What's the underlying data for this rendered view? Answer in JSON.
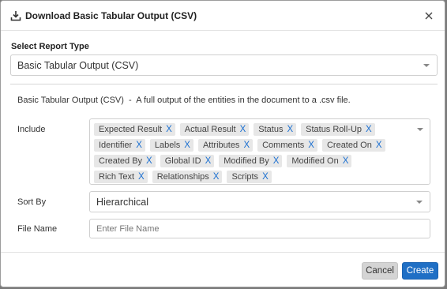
{
  "dialog": {
    "title": "Download Basic Tabular Output (CSV)",
    "title_icon": "download-icon",
    "close_icon": "close-icon"
  },
  "report_type": {
    "label": "Select Report Type",
    "value": "Basic Tabular Output (CSV)"
  },
  "description": "Basic Tabular Output (CSV)  -  A full output of the entities in the document to a .csv file.",
  "include": {
    "label": "Include",
    "remove_label": "X",
    "chips": [
      "Expected Result",
      "Actual Result",
      "Status",
      "Status Roll-Up",
      "Identifier",
      "Labels",
      "Attributes",
      "Comments",
      "Created On",
      "Created By",
      "Global ID",
      "Modified By",
      "Modified On",
      "Rich Text",
      "Relationships",
      "Scripts"
    ]
  },
  "sort_by": {
    "label": "Sort By",
    "value": "Hierarchical"
  },
  "file_name": {
    "label": "File Name",
    "placeholder": "Enter File Name",
    "value": ""
  },
  "buttons": {
    "cancel": "Cancel",
    "create": "Create"
  },
  "colors": {
    "primary": "#1f6fc5",
    "chip_bg": "#e7e7e7",
    "chip_remove": "#1a6fd1"
  }
}
